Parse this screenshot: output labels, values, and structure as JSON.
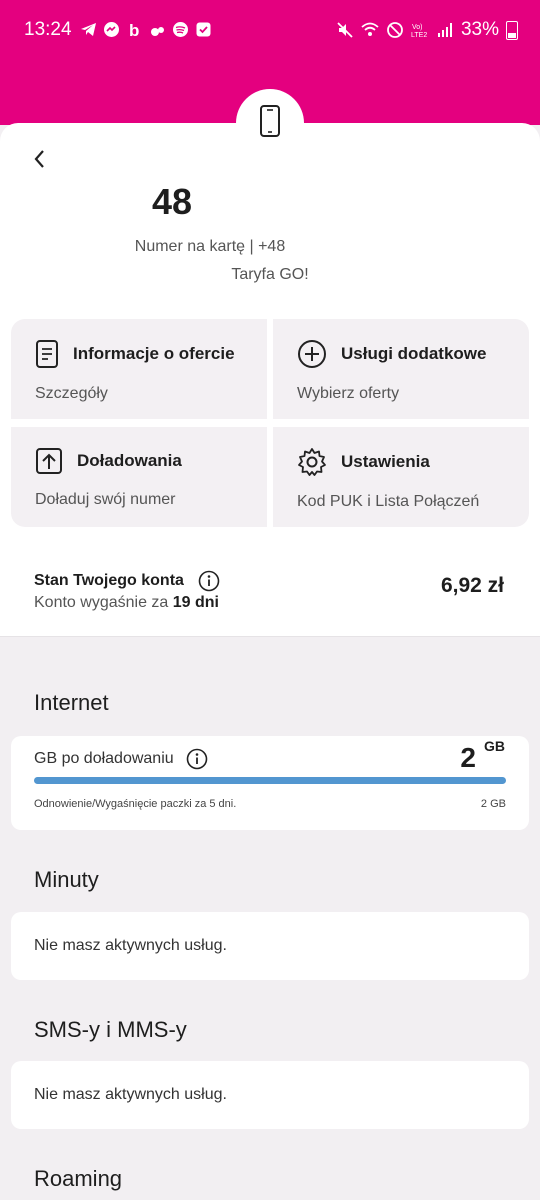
{
  "status_bar": {
    "time": "13:24",
    "battery": "33%",
    "left_icons": [
      "telegram-icon",
      "messenger-icon",
      "b-app-icon",
      "app-icon",
      "spotify-icon",
      "check-icon"
    ],
    "right_icons": [
      "mute-icon",
      "wifi-icon",
      "dnd-icon",
      "volte-icon",
      "signal-icon",
      "battery-icon"
    ],
    "brand_color": "#e4007f"
  },
  "account": {
    "number": "48",
    "type_line": "Numer na kartę | +48",
    "plan": "Taryfa GO!"
  },
  "tiles": [
    {
      "title": "Informacje o ofercie",
      "subtitle": "Szczegóły",
      "icon": "document-icon"
    },
    {
      "title": "Usługi dodatkowe",
      "subtitle": "Wybierz oferty",
      "icon": "plus-circle-icon"
    },
    {
      "title": "Doładowania",
      "subtitle": "Doładuj swój numer",
      "icon": "upload-icon"
    },
    {
      "title": "Ustawienia",
      "subtitle": "Kod PUK i Lista Połączeń",
      "icon": "gear-icon"
    }
  ],
  "balance": {
    "title": "Stan Twojego konta",
    "expiry_prefix": "Konto wygaśnie za",
    "expiry_value": "19 dni",
    "amount": "6,92 zł"
  },
  "internet": {
    "heading": "Internet",
    "label": "GB po doładowaniu",
    "value": "2",
    "unit": "GB",
    "fill_fraction": 1.0,
    "renewal": "Odnowienie/Wygaśnięcie paczki za 5 dni.",
    "total": "2 GB",
    "bar_color": "#5296d0"
  },
  "minutes": {
    "heading": "Minuty",
    "empty": "Nie masz aktywnych usług."
  },
  "sms": {
    "heading": "SMS-y i MMS-y",
    "empty": "Nie masz aktywnych usług."
  },
  "roaming": {
    "heading": "Roaming"
  }
}
